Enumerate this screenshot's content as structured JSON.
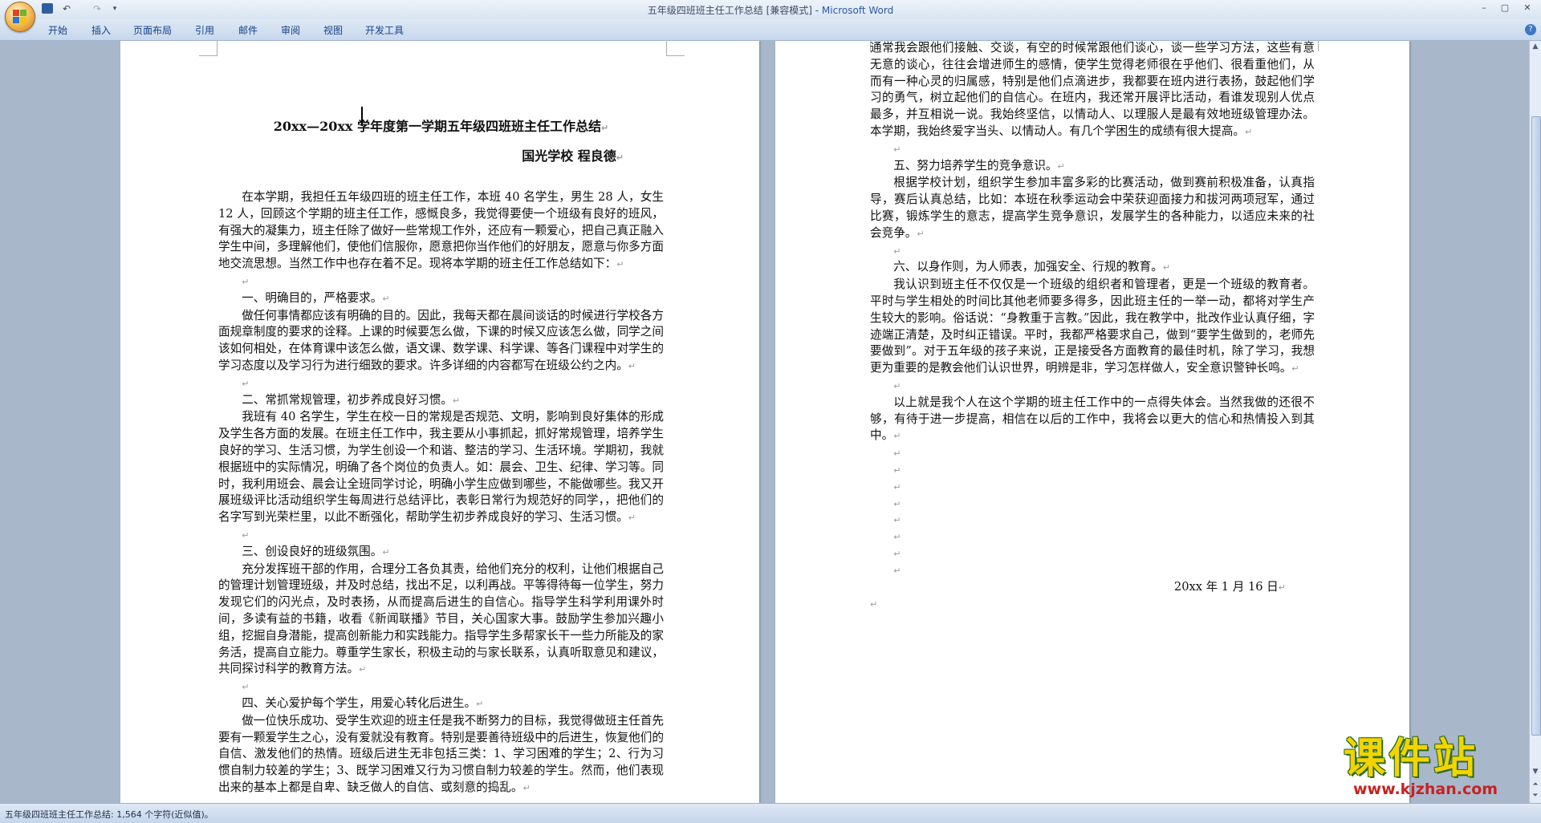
{
  "window": {
    "title": "五年级四班班主任工作总结 [兼容模式] - ",
    "app_name": "Microsoft Word",
    "controls": [
      "–",
      "▢",
      "✕"
    ]
  },
  "quick_access": {
    "undo": "↶",
    "redo": "↷",
    "dropdown": "▾"
  },
  "ribbon": {
    "tabs": [
      "开始",
      "插入",
      "页面布局",
      "引用",
      "邮件",
      "审阅",
      "视图",
      "开发工具"
    ],
    "help": "?"
  },
  "pilcrow": "↵",
  "page1": {
    "title": "20xx—20xx 学年度第一学期五年级四班班主任工作总结",
    "author": "国光学校      程良德",
    "paragraphs": [
      {
        "type": "body",
        "text": "在本学期，我担任五年级四班的班主任工作，本班 40 名学生，男生 28 人，女生 12 人，回顾这个学期的班主任工作，感慨良多，我觉得要使一个班级有良好的班风，有强大的凝集力，班主任除了做好一些常规工作外，还应有一颗爱心，把自己真正融入学生中间，多理解他们，使他们信服你，愿意把你当作他们的好朋友，愿意与你多方面地交流思想。当然工作中也存在着不足。现将本学期的班主任工作总结如下："
      },
      {
        "type": "empty",
        "text": ""
      },
      {
        "type": "head",
        "text": "一、明确目的，严格要求。"
      },
      {
        "type": "body",
        "text": "做任何事情都应该有明确的目的。因此，我每天都在晨间谈话的时候进行学校各方面规章制度的要求的诠释。上课的时候要怎么做，下课的时候又应该怎么做，同学之间该如何相处，在体育课中该怎么做，语文课、数学课、科学课、等各门课程中对学生的学习态度以及学习行为进行细致的要求。许多详细的内容都写在班级公约之内。"
      },
      {
        "type": "empty",
        "text": ""
      },
      {
        "type": "head",
        "text": "二、常抓常规管理，初步养成良好习惯。"
      },
      {
        "type": "body",
        "text": "我班有 40 名学生，学生在校一日的常规是否规范、文明，影响到良好集体的形成及学生各方面的发展。在班主任工作中，我主要从小事抓起，抓好常规管理，培养学生良好的学习、生活习惯，为学生创设一个和谐、整洁的学习、生活环境。学期初，我就根据班中的实际情况，明确了各个岗位的负责人。如：晨会、卫生、纪律、学习等。同时，我利用班会、晨会让全班同学讨论，明确小学生应做到哪些，不能做哪些。我又开展班级评比活动组织学生每周进行总结评比，表彰日常行为规范好的同学，，把他们的名字写到光荣栏里，以此不断强化，帮助学生初步养成良好的学习、生活习惯。"
      },
      {
        "type": "empty",
        "text": ""
      },
      {
        "type": "head",
        "text": "三、创设良好的班级氛围。"
      },
      {
        "type": "body",
        "text": "充分发挥班干部的作用，合理分工各负其责，给他们充分的权利，让他们根据自己的管理计划管理班级，并及时总结，找出不足，以利再战。平等得待每一位学生，努力发现它们的闪光点，及时表扬，从而提高后进生的自信心。指导学生科学利用课外时间，多读有益的书籍，收看《新闻联播》节目，关心国家大事。鼓励学生参加兴趣小组，挖掘自身潜能，提高创新能力和实践能力。指导学生多帮家长干一些力所能及的家务活，提高自立能力。尊重学生家长，积极主动的与家长联系，认真听取意见和建议，共同探讨科学的教育方法。"
      },
      {
        "type": "empty",
        "text": ""
      },
      {
        "type": "head",
        "text": "四、关心爱护每个学生，用爱心转化后进生。"
      },
      {
        "type": "body",
        "text": "做一位快乐成功、受学生欢迎的班主任是我不断努力的目标，我觉得做班主任首先要有一颗爱学生之心，没有爱就没有教育。特别是要善待班级中的后进生，恢复他们的自信、激发他们的热情。班级后进生无非包括三类：1、学习困难的学生；2、行为习惯自制力较差的学生；3、既学习困难又行为习惯自制力较差的学生。然而，他们表现出来的基本上都是自卑、缺乏做人的自信、或刻意的捣乱。"
      }
    ]
  },
  "page2": {
    "paragraphs": [
      {
        "type": "cont",
        "text": "通常我会跟他们接触、交谈，有空的时候常跟他们谈心，谈一些学习方法，这些有意无意的谈心，往往会增进师生的感情，使学生觉得老师很在乎他们、很看重他们，从而有一种心灵的归属感，特别是他们点滴进步，我都要在班内进行表扬，鼓起他们学习的勇气，树立起他们的自信心。在班内，我还常开展评比活动，看谁发现别人优点最多，并互相说一说。我始终坚信，以情动人、以理服人是最有效地班级管理办法。本学期，我始终爱字当头、以情动人。有几个学困生的成绩有很大提高。"
      },
      {
        "type": "empty",
        "text": ""
      },
      {
        "type": "head",
        "text": "五、努力培养学生的竞争意识。"
      },
      {
        "type": "body",
        "text": "根据学校计划，组织学生参加丰富多彩的比赛活动，做到赛前积极准备，认真指导，赛后认真总结，比如：本班在秋季运动会中荣获迎面接力和拔河两项冠军，通过比赛，锻炼学生的意志，提高学生竞争意识，发展学生的各种能力，以适应未来的社会竞争。"
      },
      {
        "type": "empty",
        "text": ""
      },
      {
        "type": "head",
        "text": "六、以身作则，为人师表，加强安全、行规的教育。"
      },
      {
        "type": "body",
        "text": "我认识到班主任不仅仅是一个班级的组织者和管理者，更是一个班级的教育者。平时与学生相处的时间比其他老师要多得多，因此班主任的一举一动，都将对学生产生较大的影响。俗话说：“身教重于言教。”因此，我在教学中，批改作业认真仔细，字迹端正清楚，及时纠正错误。平时，我都严格要求自己，做到“要学生做到的，老师先要做到”。对于五年级的孩子来说，正是接受各方面教育的最佳时机，除了学习，我想更为重要的是教会他们认识世界，明辨是非，学习怎样做人，安全意识警钟长鸣。"
      },
      {
        "type": "empty",
        "text": ""
      },
      {
        "type": "body",
        "text": "以上就是我个人在这个学期的班主任工作中的一点得失体会。当然我做的还很不够，有待于进一步提高，相信在以后的工作中，我将会以更大的信心和热情投入到其中。"
      },
      {
        "type": "empty",
        "text": ""
      },
      {
        "type": "empty",
        "text": ""
      },
      {
        "type": "empty",
        "text": ""
      },
      {
        "type": "empty",
        "text": ""
      },
      {
        "type": "empty",
        "text": ""
      },
      {
        "type": "empty",
        "text": ""
      },
      {
        "type": "empty",
        "text": ""
      },
      {
        "type": "empty",
        "text": ""
      },
      {
        "type": "date",
        "text": "20xx 年 1 月 16 日"
      },
      {
        "type": "last",
        "text": ""
      }
    ]
  },
  "status": {
    "text": "五年级四班班主任工作总结: 1,564 个字符(近似值)。"
  },
  "watermark": {
    "title": "课件站",
    "url": "www.kjzhan.com"
  },
  "colors": {
    "ribbon_text": "#15428b",
    "app_blue": "#2a5aa0",
    "background": "#a9b7ca"
  }
}
